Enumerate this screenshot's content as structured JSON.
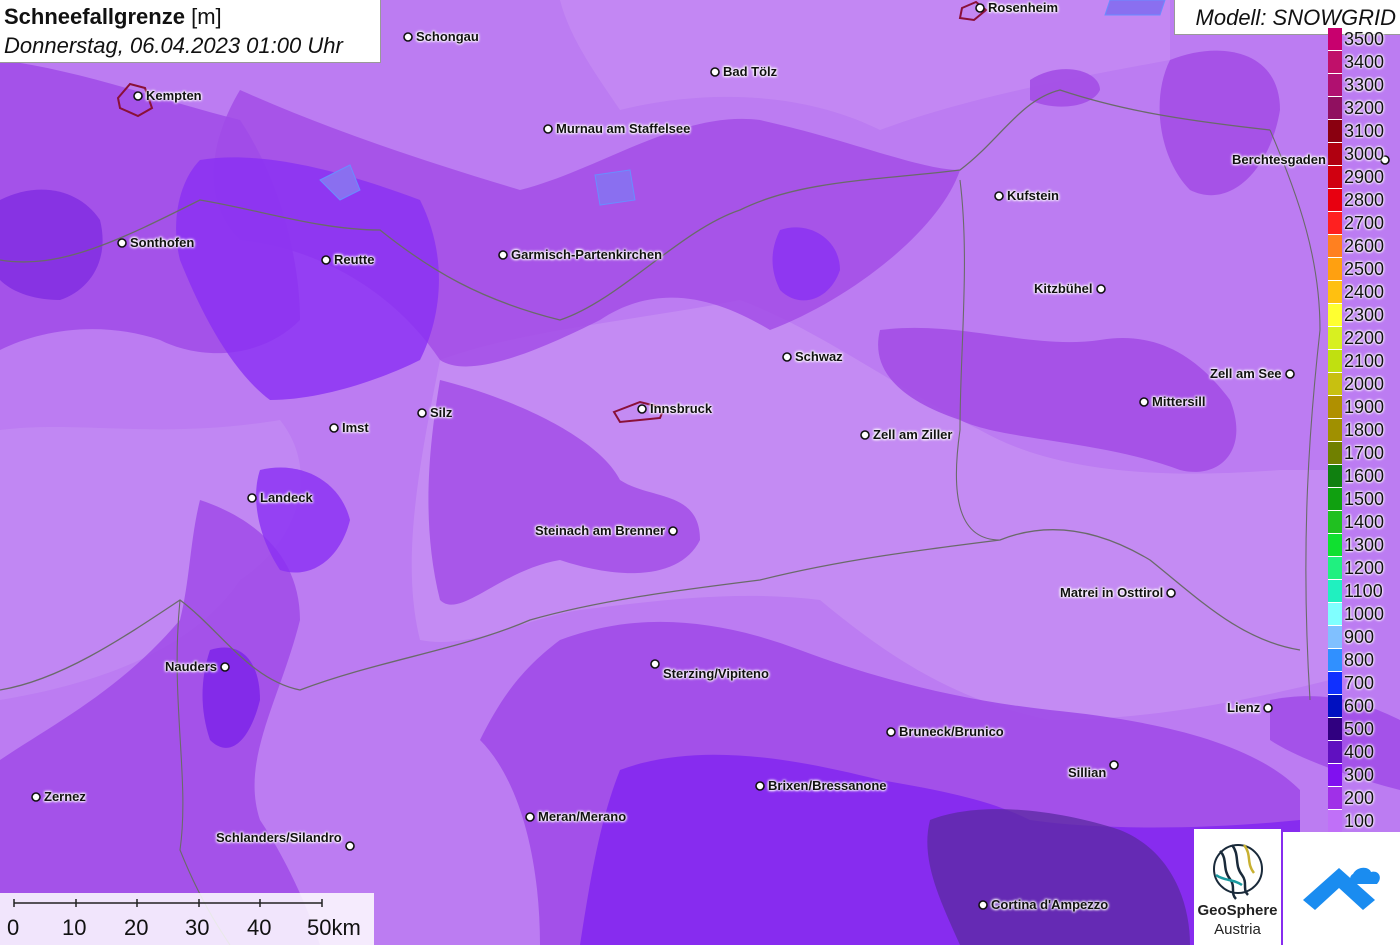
{
  "header": {
    "title": "Schneefallgrenze",
    "unit": "[m]",
    "datetime": "Donnerstag, 06.04.2023 01:00 Uhr",
    "model": "Modell: SNOWGRID"
  },
  "legend": {
    "entries": [
      {
        "label": "3500",
        "color": "#c8006e"
      },
      {
        "label": "3400",
        "color": "#c0106a"
      },
      {
        "label": "3300",
        "color": "#b01070"
      },
      {
        "label": "3200",
        "color": "#901060"
      },
      {
        "label": "3100",
        "color": "#8a0010"
      },
      {
        "label": "3000",
        "color": "#b00010"
      },
      {
        "label": "2900",
        "color": "#d00010"
      },
      {
        "label": "2800",
        "color": "#e80010"
      },
      {
        "label": "2700",
        "color": "#ff2020"
      },
      {
        "label": "2600",
        "color": "#ff8020"
      },
      {
        "label": "2500",
        "color": "#ffa010"
      },
      {
        "label": "2400",
        "color": "#ffc010"
      },
      {
        "label": "2300",
        "color": "#ffff30"
      },
      {
        "label": "2200",
        "color": "#d8f020"
      },
      {
        "label": "2100",
        "color": "#c0e010"
      },
      {
        "label": "2000",
        "color": "#c8c010"
      },
      {
        "label": "1900",
        "color": "#b09000"
      },
      {
        "label": "1800",
        "color": "#a09000"
      },
      {
        "label": "1700",
        "color": "#708000"
      },
      {
        "label": "1600",
        "color": "#108010"
      },
      {
        "label": "1500",
        "color": "#10a010"
      },
      {
        "label": "1400",
        "color": "#20c020"
      },
      {
        "label": "1300",
        "color": "#10e030"
      },
      {
        "label": "1200",
        "color": "#20f080"
      },
      {
        "label": "1100",
        "color": "#20f0c0"
      },
      {
        "label": "1000",
        "color": "#80ffff"
      },
      {
        "label": "900",
        "color": "#80c0ff"
      },
      {
        "label": "800",
        "color": "#3090ff"
      },
      {
        "label": "700",
        "color": "#1030ff"
      },
      {
        "label": "600",
        "color": "#0010c0"
      },
      {
        "label": "500",
        "color": "#300080"
      },
      {
        "label": "400",
        "color": "#6010c0"
      },
      {
        "label": "300",
        "color": "#8010f0"
      },
      {
        "label": "200",
        "color": "#a030e8"
      },
      {
        "label": "100",
        "color": "#c070f8"
      }
    ]
  },
  "cities": [
    {
      "name": "Rosenheim"
    },
    {
      "name": "Schongau"
    },
    {
      "name": "Kempten"
    },
    {
      "name": "Bad Tölz"
    },
    {
      "name": "Murnau am Staffelsee"
    },
    {
      "name": "Berchtesgaden"
    },
    {
      "name": "Kufstein"
    },
    {
      "name": "Sonthofen"
    },
    {
      "name": "Reutte"
    },
    {
      "name": "Garmisch-Partenkirchen"
    },
    {
      "name": "Kitzbühel"
    },
    {
      "name": "Schwaz"
    },
    {
      "name": "Zell am See"
    },
    {
      "name": "Mittersill"
    },
    {
      "name": "Imst"
    },
    {
      "name": "Silz"
    },
    {
      "name": "Innsbruck"
    },
    {
      "name": "Zell am Ziller"
    },
    {
      "name": "Landeck"
    },
    {
      "name": "Steinach am Brenner"
    },
    {
      "name": "Matrei in Osttirol"
    },
    {
      "name": "Nauders"
    },
    {
      "name": "Sterzing/Vipiteno"
    },
    {
      "name": "Lienz"
    },
    {
      "name": "Bruneck/Brunico"
    },
    {
      "name": "Sillian"
    },
    {
      "name": "Brixen/Bressanone"
    },
    {
      "name": "Zernez"
    },
    {
      "name": "Meran/Merano"
    },
    {
      "name": "Schlanders/Silandro"
    },
    {
      "name": "Cortina d'Ampezzo"
    }
  ],
  "scalebar": {
    "labels": [
      "0",
      "10",
      "20",
      "30",
      "40",
      "50km"
    ]
  },
  "logos": {
    "geosphere_line1": "GeoSphere",
    "geosphere_line2": "Austria"
  },
  "colors": {
    "field_light": "#c07bf2",
    "field_mid": "#a04de8",
    "field_dark": "#7a1ff0",
    "snowgrid_blue": "#1a8cf0"
  }
}
